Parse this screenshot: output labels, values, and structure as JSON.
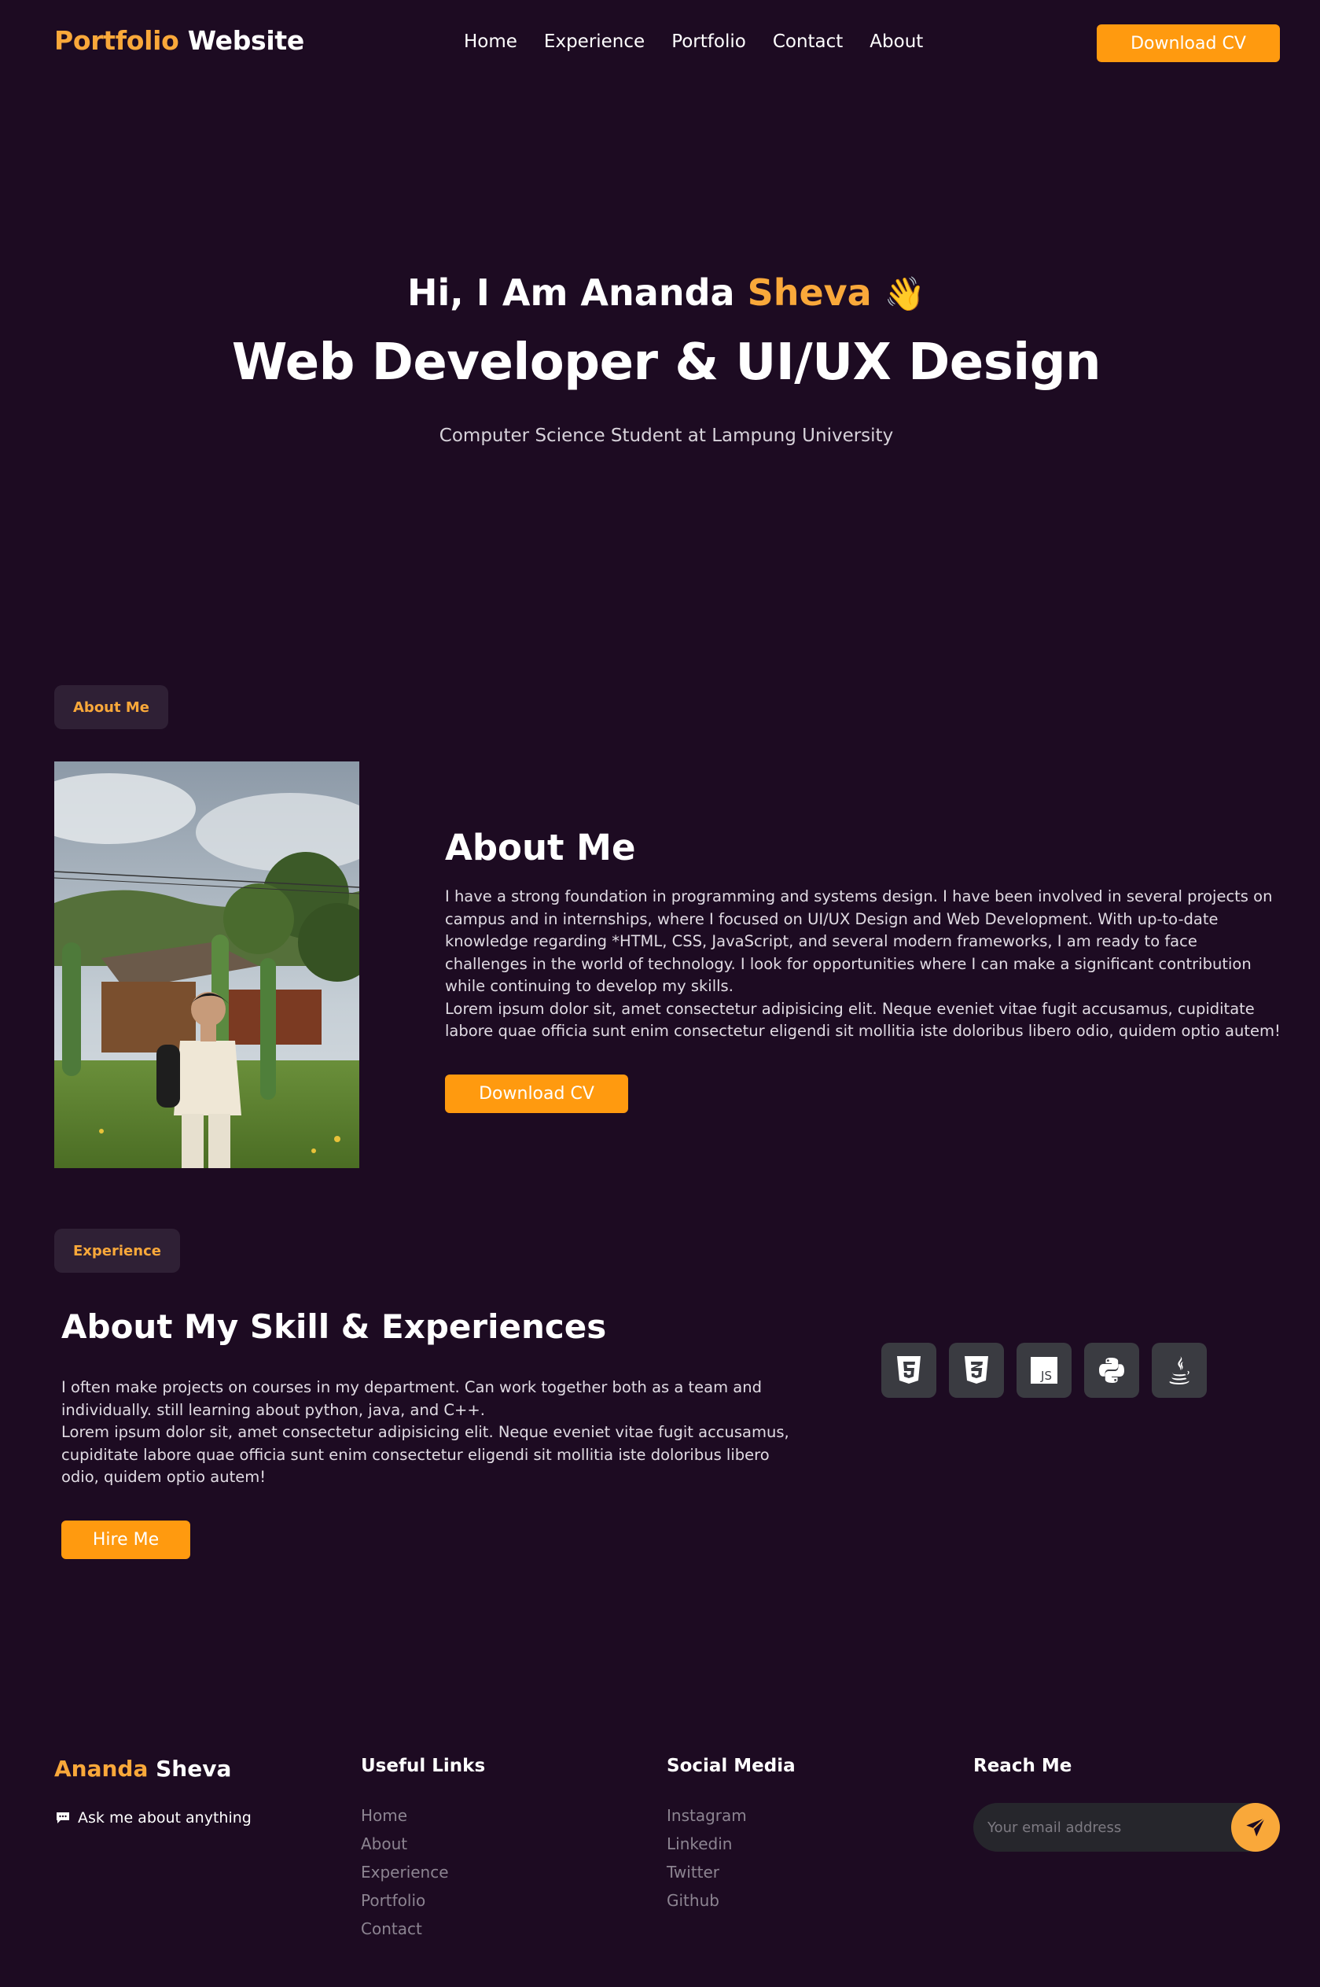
{
  "nav": {
    "brand_part1": "Portfolio",
    "brand_part2": "Website",
    "links": [
      "Home",
      "Experience",
      "Portfolio",
      "Contact",
      "About"
    ],
    "cta": "Download CV"
  },
  "hero": {
    "greeting_prefix": "Hi, I Am Ananda",
    "greeting_highlight": "Sheva",
    "wave": "👋",
    "title": "Web Developer & UI/UX Design",
    "subtitle": "Computer Science Student at Lampung University"
  },
  "about": {
    "badge": "About Me",
    "title": "About Me",
    "paragraph1": "I have a strong foundation in programming and systems design. I have been involved in several projects on campus and in internships, where I focused on UI/UX Design and Web Development. With up-to-date knowledge regarding *HTML, CSS, JavaScript, and several modern frameworks, I am ready to face challenges in the world of technology. I look for opportunities where I can make a significant contribution while continuing to develop my skills.",
    "paragraph2": "Lorem ipsum dolor sit, amet consectetur adipisicing elit. Neque eveniet vitae fugit accusamus, cupiditate labore quae officia sunt enim consectetur eligendi sit mollitia iste doloribus libero odio, quidem optio autem!",
    "cta": "Download CV"
  },
  "experience": {
    "badge": "Experience",
    "title": "About My Skill & Experiences",
    "paragraph1": "I often make projects on courses in my department. Can work together both as a team and individually. still learning about python, java, and C++.",
    "paragraph2": "Lorem ipsum dolor sit, amet consectetur adipisicing elit. Neque eveniet vitae fugit accusamus, cupiditate labore quae officia sunt enim consectetur eligendi sit mollitia iste doloribus libero odio, quidem optio autem!",
    "cta": "Hire Me",
    "skills": [
      "html5-icon",
      "css3-icon",
      "javascript-icon",
      "python-icon",
      "java-icon"
    ],
    "js_label": "JS"
  },
  "footer": {
    "brand_part1": "Ananda",
    "brand_part2": "Sheva",
    "tagline": "Ask me about anything",
    "useful_links_title": "Useful Links",
    "useful_links": [
      "Home",
      "About",
      "Experience",
      "Portfolio",
      "Contact"
    ],
    "social_title": "Social Media",
    "social_links": [
      "Instagram",
      "Linkedin",
      "Twitter",
      "Github"
    ],
    "reach_title": "Reach Me",
    "email_placeholder": "Your email address"
  },
  "colors": {
    "background": "#1d0b22",
    "accent": "#f9a83a",
    "button": "#ff9a0f"
  }
}
